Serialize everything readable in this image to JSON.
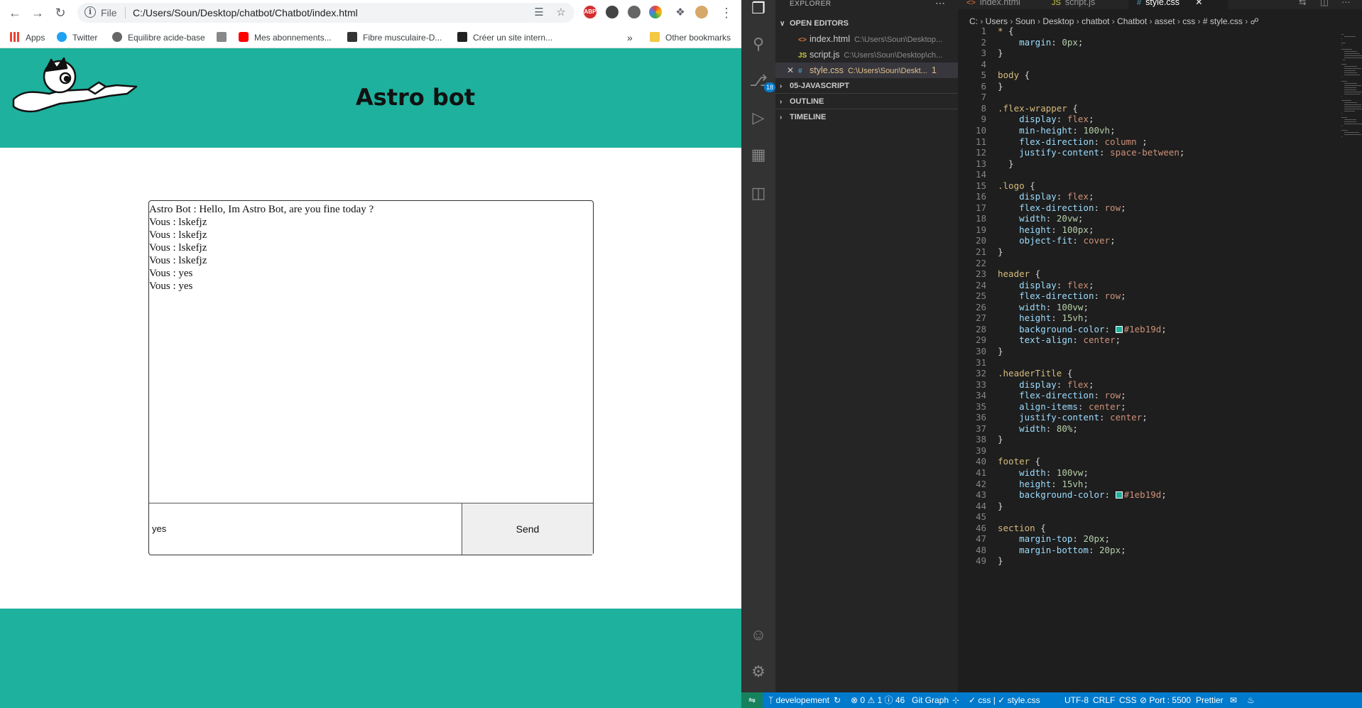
{
  "browser": {
    "url_scheme": "File",
    "url": "C:/Users/Soun/Desktop/chatbot/Chatbot/index.html",
    "bookmarks": [
      {
        "label": "Apps",
        "color": "#4285f4"
      },
      {
        "label": "Twitter",
        "color": "#1da1f2"
      },
      {
        "label": "Equilibre acide-base",
        "color": "#666666"
      },
      {
        "label": "",
        "color": "#888888"
      },
      {
        "label": "Mes abonnements...",
        "color": "#ff0000"
      },
      {
        "label": "Fibre musculaire-D...",
        "color": "#333333"
      },
      {
        "label": "Créer un site intern...",
        "color": "#222222"
      }
    ],
    "bookmarks_overflow": "»",
    "other_bookmarks": "Other bookmarks",
    "extensions": [
      "ABP"
    ]
  },
  "site": {
    "title": "Astro bot",
    "chat_lines": [
      "Astro Bot : Hello, Im Astro Bot, are you fine today ?",
      "Vous : lskefjz",
      "Vous : lskefjz",
      "Vous : lskefjz",
      "Vous : lskefjz",
      "Vous : yes",
      "Vous : yes"
    ],
    "input_value": "yes",
    "send_label": "Send",
    "brand_color": "#1eb19d"
  },
  "vscode": {
    "explorer_title": "EXPLORER",
    "sections": {
      "open_editors": "OPEN EDITORS",
      "project": "05-JAVASCRIPT",
      "outline": "OUTLINE",
      "timeline": "TIMELINE"
    },
    "open_editors": [
      {
        "name": "index.html",
        "path": "C:\\Users\\Soun\\Desktop...",
        "icon": "<>",
        "icon_color": "#e37933"
      },
      {
        "name": "script.js",
        "path": "C:\\Users\\Soun\\Desktop\\ch...",
        "icon": "JS",
        "icon_color": "#cbcb41"
      },
      {
        "name": "style.css",
        "path": "C:\\Users\\Soun\\Deskt...",
        "icon": "#",
        "icon_color": "#519aba",
        "problems": "1"
      }
    ],
    "scm_badge": "18",
    "tabs": [
      {
        "name": "index.html",
        "icon": "<>",
        "icon_color": "#e37933"
      },
      {
        "name": "script.js",
        "icon": "JS",
        "icon_color": "#cbcb41"
      },
      {
        "name": "style.css",
        "icon": "#",
        "icon_color": "#519aba"
      }
    ],
    "breadcrumbs": [
      "C:",
      "Users",
      "Soun",
      "Desktop",
      "chatbot",
      "Chatbot",
      "asset",
      "css",
      "# style.css",
      "☍"
    ],
    "code_lines": [
      "* {",
      "    margin: 0px;",
      "}",
      "",
      "body {",
      "}",
      "",
      ".flex-wrapper {",
      "    display: flex;",
      "    min-height: 100vh;",
      "    flex-direction: column ;",
      "    justify-content: space-between;",
      "  }",
      "",
      ".logo {",
      "    display: flex;",
      "    flex-direction: row;",
      "    width: 20vw;",
      "    height: 100px;",
      "    object-fit: cover;",
      "}",
      "",
      "header {",
      "    display: flex;",
      "    flex-direction: row;",
      "    width: 100vw;",
      "    height: 15vh;",
      "    background-color: #1eb19d;",
      "    text-align: center;",
      "}",
      "",
      ".headerTitle {",
      "    display: flex;",
      "    flex-direction: row;",
      "    align-items: center;",
      "    justify-content: center;",
      "    width: 80%;",
      "}",
      "",
      "footer {",
      "    width: 100vw;",
      "    height: 15vh;",
      "    background-color: #1eb19d;",
      "}",
      "",
      "section {",
      "    margin-top: 20px;",
      "    margin-bottom: 20px;",
      "}"
    ],
    "status": {
      "branch": "developement",
      "errors": "0",
      "warnings": "1",
      "info": "46",
      "git_graph": "Git Graph",
      "lint": "✓ css | ✓ style.css",
      "encoding": "UTF-8",
      "eol": "CRLF",
      "language": "CSS",
      "port": "Port : 5500",
      "prettier": "Prettier"
    }
  }
}
